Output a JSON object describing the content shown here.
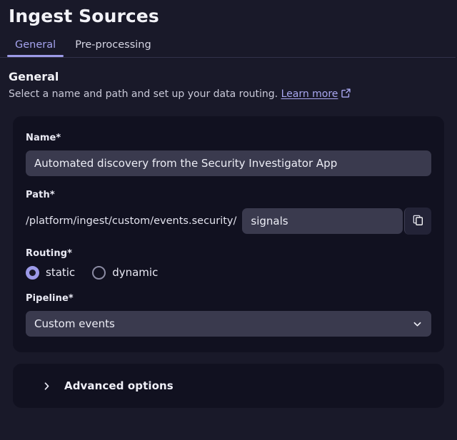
{
  "header": {
    "title": "Ingest Sources"
  },
  "tabs": [
    {
      "label": "General",
      "active": true
    },
    {
      "label": "Pre-processing",
      "active": false
    }
  ],
  "section": {
    "heading": "General",
    "description": "Select a name and path and set up your data routing.",
    "learn_more_label": "Learn more",
    "learn_more_icon": "external-link-icon"
  },
  "form": {
    "name_field": {
      "label": "Name*",
      "value": "Automated discovery from the Security Investigator App",
      "placeholder": "Name"
    },
    "path_field": {
      "label": "Path*",
      "prefix": "/platform/ingest/custom/events.security/",
      "value": "signals",
      "placeholder": "path",
      "copy_icon": "copy-icon"
    },
    "routing_field": {
      "label": "Routing*",
      "options": [
        {
          "label": "static",
          "selected": true
        },
        {
          "label": "dynamic",
          "selected": false
        }
      ]
    },
    "pipeline_field": {
      "label": "Pipeline*",
      "value": "Custom events",
      "chevron_icon": "chevron-down-icon"
    }
  },
  "advanced": {
    "label": "Advanced options",
    "chevron_icon": "chevron-right-icon",
    "expanded": false
  },
  "colors": {
    "page_background": "#191929",
    "card_background": "#111120",
    "input_background": "#3a3a4e",
    "accent": "#9c9ae8",
    "link": "#a9a7f0",
    "text_primary": "#f2f2f7",
    "text_secondary": "#c9c9d8"
  }
}
